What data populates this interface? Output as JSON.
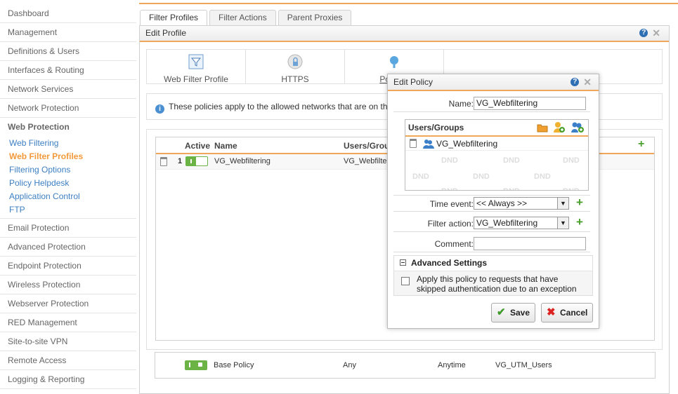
{
  "sidebar": {
    "items_top": [
      "Dashboard",
      "Management",
      "Definitions & Users",
      "Interfaces & Routing",
      "Network Services",
      "Network Protection"
    ],
    "section": "Web Protection",
    "subitems": [
      "Web Filtering",
      "Web Filter Profiles",
      "Filtering Options",
      "Policy Helpdesk",
      "Application Control",
      "FTP"
    ],
    "active_subitem": "Web Filter Profiles",
    "items_bottom": [
      "Email Protection",
      "Advanced Protection",
      "Endpoint Protection",
      "Wireless Protection",
      "Webserver Protection",
      "RED Management",
      "Site-to-site VPN",
      "Remote Access",
      "Logging & Reporting"
    ]
  },
  "tabs": [
    "Filter Profiles",
    "Filter Actions",
    "Parent Proxies"
  ],
  "panel": {
    "title": "Edit Profile",
    "subtabs": [
      "Web Filter Profile",
      "HTTPS",
      "Policies"
    ],
    "info": "These policies apply to the allowed networks that are on th",
    "table": {
      "headers": {
        "active": "Active",
        "name": "Name",
        "users": "Users/Grou"
      },
      "row": {
        "num": "1",
        "name": "VG_Webfiltering",
        "users": "VG_Webfilterin"
      }
    },
    "base_policy": {
      "name": "Base Policy",
      "users": "Any",
      "time": "Anytime",
      "action": "VG_UTM_Users"
    }
  },
  "dialog": {
    "title": "Edit Policy",
    "name_label": "Name:",
    "name_value": "VG_Webfiltering",
    "users_groups_label": "Users/Groups",
    "user_entry": "VG_Webfiltering",
    "dnd": "DND",
    "time_label": "Time event:",
    "time_value": "<< Always >>",
    "filter_label": "Filter action:",
    "filter_value": "VG_Webfiltering",
    "comment_label": "Comment:",
    "comment_value": "",
    "advanced_label": "Advanced Settings",
    "advanced_option_line1": "Apply this policy to requests that have",
    "advanced_option_line2": "skipped authentication due to an exception",
    "save": "Save",
    "cancel": "Cancel"
  },
  "colors": {
    "accent": "#f0a75a",
    "link": "#3c7fc2",
    "active": "#f29a3b",
    "toggle": "#6ab344"
  },
  "icons": [
    "help-icon",
    "close-icon",
    "filter-icon",
    "https-icon",
    "policies-icon",
    "info-icon",
    "trash-icon",
    "add-icon",
    "folder-icon",
    "add-user-icon",
    "add-group-icon",
    "user-group-icon",
    "check-icon",
    "x-icon"
  ]
}
